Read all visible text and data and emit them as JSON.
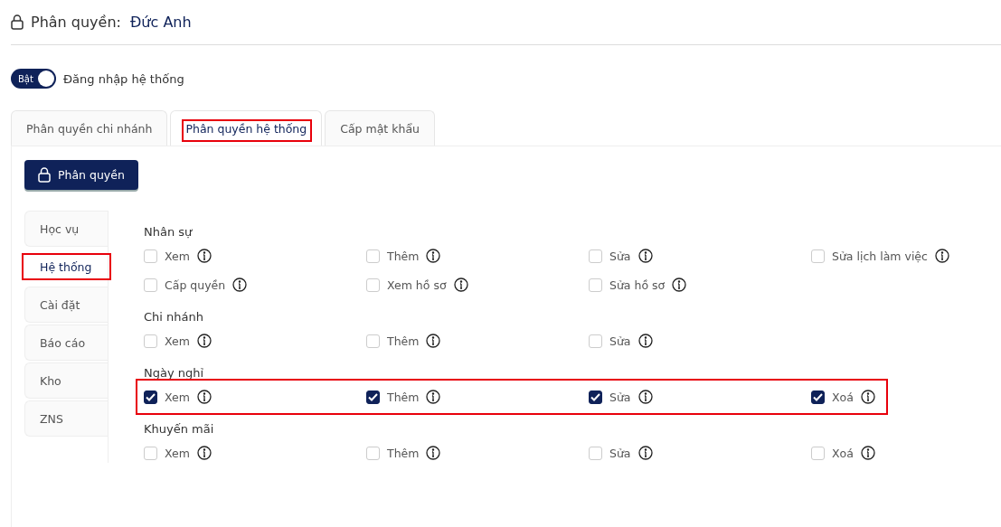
{
  "header": {
    "title": "Phân quyền:",
    "user": "Đức Anh"
  },
  "login_toggle": {
    "label": "Bật",
    "on": true,
    "caption": "Đăng nhập hệ thống"
  },
  "tabs": [
    {
      "label": "Phân quyền chi nhánh",
      "selected": false,
      "highlighted": false
    },
    {
      "label": "Phân quyền hệ thống",
      "selected": true,
      "highlighted": true
    },
    {
      "label": "Cấp mật khẩu",
      "selected": false,
      "highlighted": false
    }
  ],
  "action_button": "Phân quyền",
  "sidebar": {
    "items": [
      {
        "label": "Học vụ",
        "selected": false,
        "highlighted": false
      },
      {
        "label": "Hệ thống",
        "selected": true,
        "highlighted": true
      },
      {
        "label": "Cài đặt",
        "selected": false,
        "highlighted": false
      },
      {
        "label": "Báo cáo",
        "selected": false,
        "highlighted": false
      },
      {
        "label": "Kho",
        "selected": false,
        "highlighted": false
      },
      {
        "label": "ZNS",
        "selected": false,
        "highlighted": false
      }
    ]
  },
  "groups": [
    {
      "title": "Nhân sự",
      "highlighted": false,
      "permissions": [
        {
          "label": "Xem",
          "checked": false
        },
        {
          "label": "Thêm",
          "checked": false
        },
        {
          "label": "Sửa",
          "checked": false
        },
        {
          "label": "Sửa lịch làm việc",
          "checked": false
        },
        {
          "label": "Cấp quyền",
          "checked": false
        },
        {
          "label": "Xem hồ sơ",
          "checked": false
        },
        {
          "label": "Sửa hồ sơ",
          "checked": false
        }
      ]
    },
    {
      "title": "Chi nhánh",
      "highlighted": false,
      "permissions": [
        {
          "label": "Xem",
          "checked": false
        },
        {
          "label": "Thêm",
          "checked": false
        },
        {
          "label": "Sửa",
          "checked": false
        }
      ]
    },
    {
      "title": "Ngày nghỉ",
      "highlighted": true,
      "permissions": [
        {
          "label": "Xem",
          "checked": true
        },
        {
          "label": "Thêm",
          "checked": true
        },
        {
          "label": "Sửa",
          "checked": true
        },
        {
          "label": "Xoá",
          "checked": true
        }
      ]
    },
    {
      "title": "Khuyến mãi",
      "highlighted": false,
      "permissions": [
        {
          "label": "Xem",
          "checked": false
        },
        {
          "label": "Thêm",
          "checked": false
        },
        {
          "label": "Sửa",
          "checked": false
        },
        {
          "label": "Xoá",
          "checked": false
        }
      ]
    }
  ]
}
